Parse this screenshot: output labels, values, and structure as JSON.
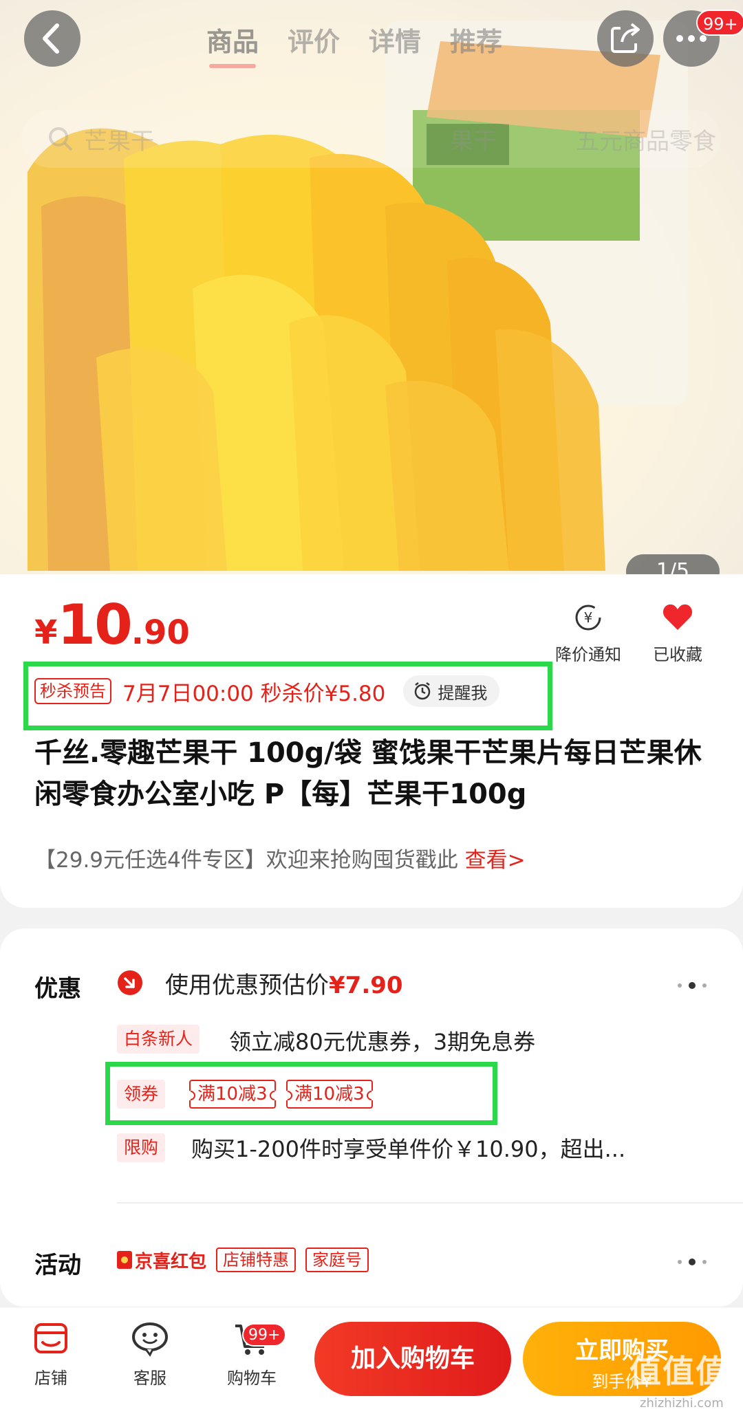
{
  "header": {
    "tabs": [
      "商品",
      "评价",
      "详情",
      "推荐"
    ],
    "badge": "99+",
    "search_placeholder": "芒果干",
    "search_right_1": "果干",
    "search_right_2": "五元商品零食"
  },
  "hero": {
    "counter": "1/5"
  },
  "price": {
    "yen": "¥",
    "int": "10",
    "dec": ".90"
  },
  "actions": {
    "notify": "降价通知",
    "favorite": "已收藏"
  },
  "flash": {
    "tag": "秒杀预告",
    "text": "7月7日00:00 秒杀价¥5.80",
    "remind": "提醒我"
  },
  "product": {
    "title": "千丝.零趣芒果干 100g/袋 蜜饯果干芒果片每日芒果休闲零食办公室小吃 P【每】芒果干100g",
    "promo": "【29.9元任选4件专区】欢迎来抢购囤货戳此",
    "promo_link": "查看>"
  },
  "offers": {
    "label": "优惠",
    "estimate_prefix": "使用优惠预估价",
    "estimate_value": "¥7.90",
    "baitiao_tag": "白条新人",
    "baitiao_text": "领立减80元优惠券，3期免息券",
    "coupon_tag": "领券",
    "coupons": [
      "满10减3",
      "满10减3"
    ],
    "limit_tag": "限购",
    "limit_text": "购买1-200件时享受单件价￥10.90，超出..."
  },
  "activity": {
    "label": "活动",
    "jx": "京喜红包",
    "chips": [
      "店铺特惠",
      "家庭号"
    ]
  },
  "bottom": {
    "store": "店铺",
    "service": "客服",
    "cart": "购物车",
    "cart_badge": "99+",
    "add_cart": "加入购物车",
    "buy_now": "立即购买",
    "buy_sub": "到手价¥",
    "watermark": "值值值",
    "watermark_url": "zhizhizhi.com"
  },
  "colors": {
    "accent": "#e4221a",
    "highlight": "#2bd84a",
    "buy": "#ffa500"
  }
}
